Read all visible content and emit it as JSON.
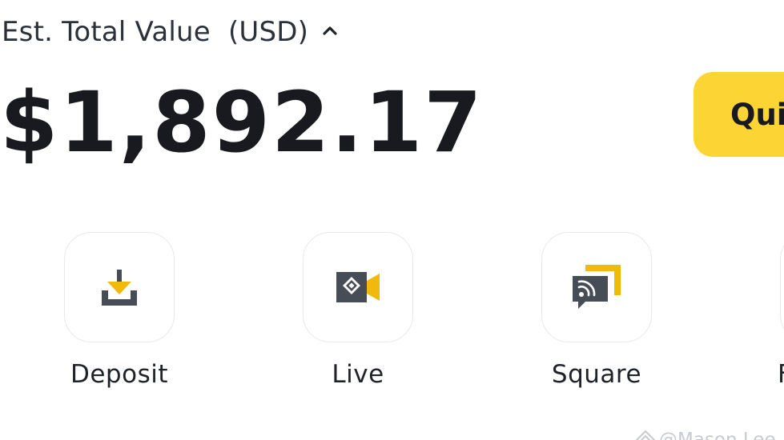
{
  "header": {
    "est_label": "Est. Total Value",
    "currency": "(USD)",
    "total_value": "$1,892.17"
  },
  "quick_button": {
    "label": "Quic"
  },
  "actions": [
    {
      "label": "Deposit",
      "icon": "download-tray-icon"
    },
    {
      "label": "Live",
      "icon": "video-camera-icon"
    },
    {
      "label": "Square",
      "icon": "feed-chat-icon"
    },
    {
      "label": "F",
      "icon": "unknown-icon"
    }
  ],
  "watermark": {
    "text": "@Mason Lee"
  },
  "colors": {
    "accent_yellow": "#fcd535",
    "icon_dark": "#474d57",
    "icon_yellow": "#f0b90b",
    "text_primary": "#181a20"
  }
}
